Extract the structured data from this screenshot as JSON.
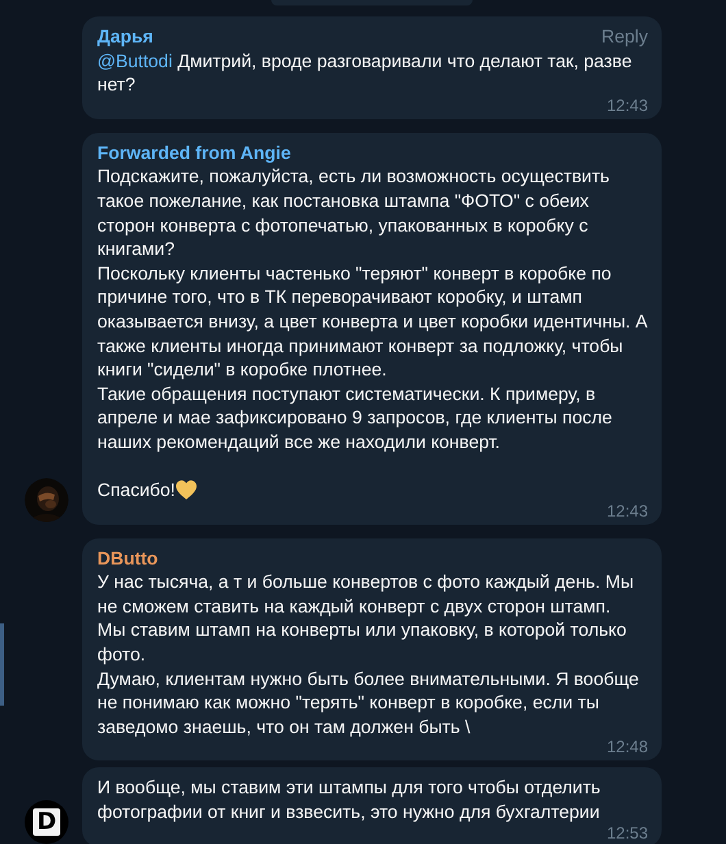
{
  "groups": [
    {
      "messages": [
        {
          "sender": "Дарья",
          "color": "#5eb5f7",
          "reply": "Reply",
          "mention": "@Buttodi",
          "text": "Дмитрий, вроде разговаривали что делают так, разве нет?",
          "heart": false,
          "time": "12:43"
        }
      ]
    },
    {
      "avatar": {
        "kind": "picture"
      },
      "messages": [
        {
          "sender": "Forwarded from Angie",
          "color": "#5eb5f7",
          "text": "Подскажите, пожалуйста, есть ли возможность осуществить такое пожелание, как постановка штампа \"ФОТО\" с обеих сторон конверта с фотопечатью, упакованных в коробку с книгами?\nПоскольку клиенты частенько \"теряют\" конверт в коробке по причине того, что в ТК переворачивают коробку, и штамп оказывается внизу, а цвет конверта и цвет коробки идентичны. А также клиенты иногда принимают конверт за подложку, чтобы книги \"сидели\" в коробке плотнее.\nТакие обращения поступают систематически. К примеру, в апреле и мае зафиксировано 9 запросов, где клиенты после наших рекомендаций все же находили конверт.\n\nСпасибо!",
          "heart": true,
          "time": "12:43"
        }
      ]
    },
    {
      "avatar": {
        "kind": "letter",
        "letter": "D"
      },
      "messages": [
        {
          "sender": "DButto",
          "color": "#e9965a",
          "text": "У нас тысяча, а т и больше конвертов с фото каждый день. Мы не сможем ставить на каждый конверт с двух сторон штамп.\nМы ставим штамп на конверты или упаковку, в которой только фото.\nДумаю, клиентам нужно быть более внимательными. Я вообще не понимаю как можно \"терять\" конверт в коробке, если ты заведомо знаешь, что он там должен быть \\",
          "heart": false,
          "time": "12:48"
        },
        {
          "text": "И вообще, мы ставим эти штампы для того чтобы отделить фотографии от книг и взвесить, это нужно для бухгалтерии",
          "heart": false,
          "time": "12:53"
        }
      ]
    }
  ]
}
